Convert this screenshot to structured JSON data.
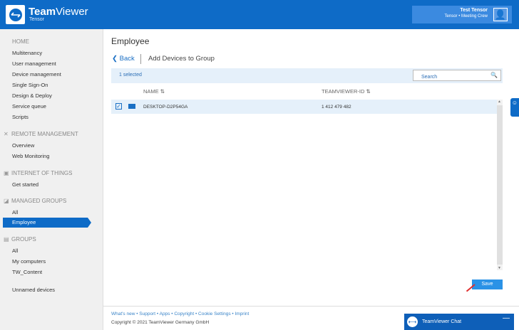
{
  "header": {
    "brand_bold": "Team",
    "brand_rest": "Viewer",
    "company": "Tensor",
    "user_name": "Test Tensor",
    "user_role": "Tensor • Meeting Crew"
  },
  "sidebar": {
    "home": "HOME",
    "home_items": [
      "Multitenancy",
      "User management",
      "Device management",
      "Single Sign-On",
      "Design & Deploy",
      "Service queue",
      "Scripts"
    ],
    "remote": "REMOTE MANAGEMENT",
    "remote_items": [
      "Overview",
      "Web Monitoring"
    ],
    "iot": "INTERNET OF THINGS",
    "iot_items": [
      "Get started"
    ],
    "managed": "MANAGED GROUPS",
    "managed_items": [
      "All",
      "Employee"
    ],
    "groups": "GROUPS",
    "groups_items": [
      "All",
      "My computers",
      "TW_Content"
    ],
    "unnamed": "Unnamed devices"
  },
  "main": {
    "title": "Employee",
    "back": "Back",
    "breadcrumb": "Add Devices to Group",
    "selected": "1 selected",
    "search_placeholder": "Search",
    "columns": [
      "NAME",
      "TEAMVIEWER-ID"
    ],
    "rows": [
      {
        "name": "DESKTOP-D2P54GA",
        "id": "1 412 479 482",
        "checked": true
      }
    ],
    "save": "Save"
  },
  "footer": {
    "links": [
      "What's new",
      "Support",
      "Apps",
      "Copyright",
      "Cookie Settings",
      "Imprint"
    ],
    "copyright": "Copyright © 2021 TeamViewer Germany GmbH"
  },
  "chat": {
    "title": "TeamViewer Chat"
  }
}
